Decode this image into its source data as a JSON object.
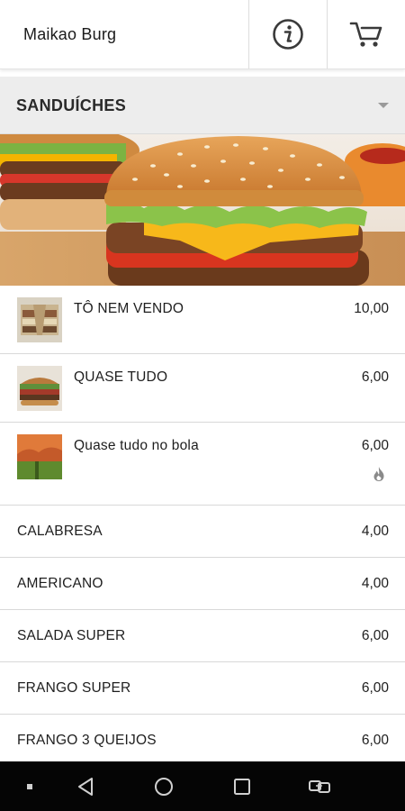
{
  "header": {
    "title": "Maikao Burg",
    "info_icon": "info-icon",
    "cart_icon": "cart-icon"
  },
  "category": {
    "selected": "SANDUÍCHES"
  },
  "items": [
    {
      "name": "TÔ NEM VENDO",
      "price": "10,00",
      "thumb": "sandwich-photo"
    },
    {
      "name": "QUASE TUDO",
      "price": "6,00",
      "thumb": "burger-photo"
    },
    {
      "name": "Quase tudo no bola",
      "price": "6,00",
      "thumb": "landscape-photo",
      "badge": "flame-icon"
    },
    {
      "name": "CALABRESA",
      "price": "4,00"
    },
    {
      "name": "AMERICANO",
      "price": "4,00"
    },
    {
      "name": "SALADA SUPER",
      "price": "6,00"
    },
    {
      "name": "FRANGO SUPER",
      "price": "6,00"
    },
    {
      "name": "FRANGO 3 QUEIJOS",
      "price": "6,00"
    }
  ],
  "navbar": {
    "icons": [
      "dot-icon",
      "back-icon",
      "home-icon",
      "recents-icon",
      "screen-switch-icon"
    ]
  }
}
